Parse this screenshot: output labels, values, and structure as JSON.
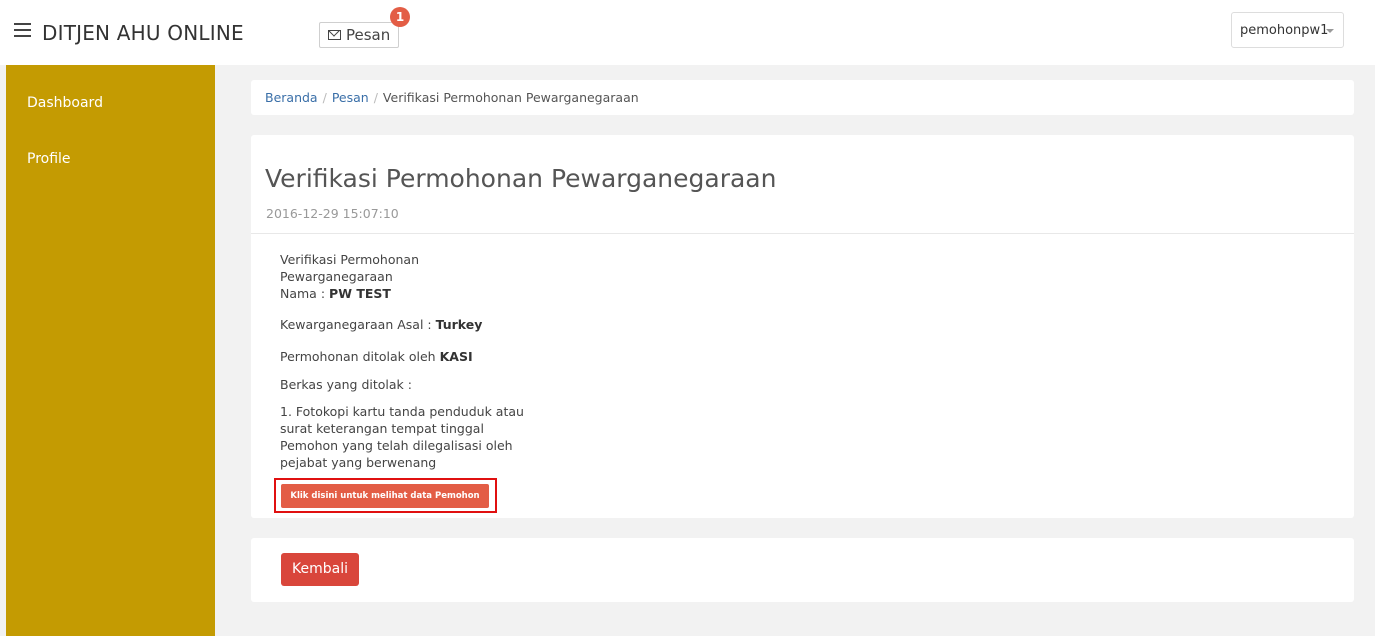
{
  "app": {
    "title": "DITJEN AHU ONLINE",
    "menu_icon": "hamburger-menu-icon"
  },
  "header": {
    "pesan_label": "Pesan",
    "pesan_icon": "envelope-icon",
    "pesan_badge": "1",
    "user": "pemohonpw1",
    "badge_color": "#e35d45"
  },
  "sidebar": {
    "color": "#c49b02",
    "items": [
      {
        "label": "Dashboard"
      },
      {
        "label": "Profile"
      }
    ]
  },
  "breadcrumb": {
    "items": [
      "Beranda",
      "Pesan"
    ],
    "separator": "/",
    "current": "Verifikasi Permohonan Pewarganegaraan"
  },
  "message": {
    "title": "Verifikasi Permohonan Pewarganegaraan",
    "date": "2016-12-29 15:07:10",
    "heading_line1": "Verifikasi Permohonan",
    "heading_line2": "Pewarganegaraan",
    "nama_label": "Nama :",
    "nama_value": "PW TEST",
    "kewarganegaraan_label": "Kewarganegaraan Asal :",
    "kewarganegaraan_value": "Turkey",
    "ditolak_label": "Permohonan ditolak oleh",
    "ditolak_value": "KASI",
    "berkas_label": "Berkas yang ditolak :",
    "berkas_lines": [
      "1. Fotokopi kartu tanda penduduk atau",
      "surat keterangan tempat tinggal",
      "Pemohon yang telah dilegalisasi oleh",
      "pejabat yang berwenang"
    ],
    "view_button": "Klik disini untuk melihat data Pemohon"
  },
  "footer": {
    "back_button": "Kembali",
    "back_color": "#d9463b"
  }
}
